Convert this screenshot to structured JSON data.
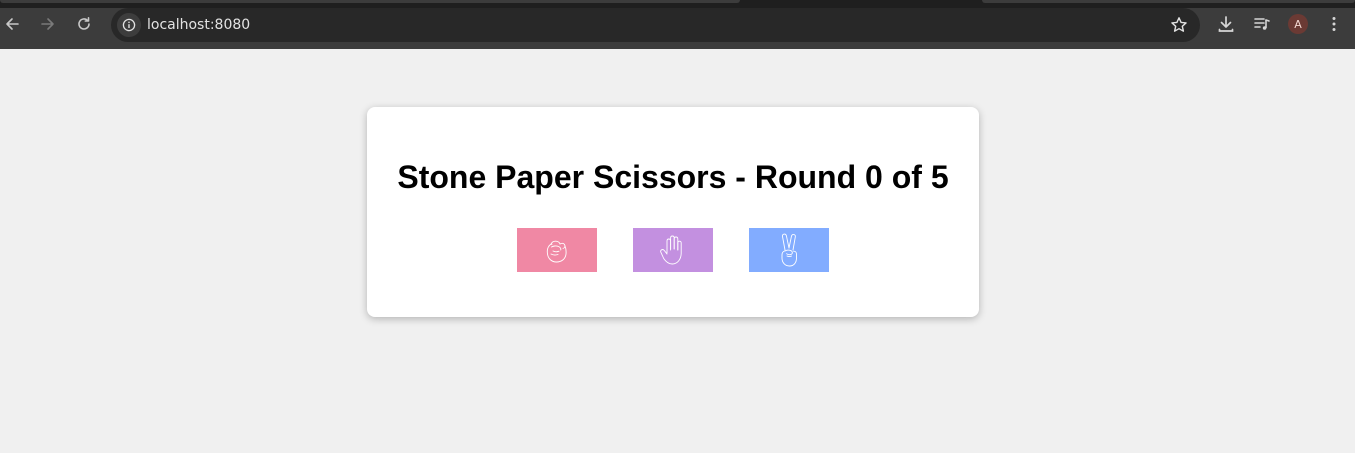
{
  "browser": {
    "url": "localhost:8080",
    "profile_initial": "A",
    "icons": {
      "back": "back-arrow-icon",
      "forward": "forward-arrow-icon",
      "reload": "reload-icon",
      "site_info": "info-icon",
      "bookmark": "star-icon",
      "downloads": "download-icon",
      "media": "media-queue-icon",
      "menu": "kebab-menu-icon"
    }
  },
  "game": {
    "title": "Stone Paper Scissors - Round 0 of 5",
    "choices": [
      {
        "name": "stone",
        "icon": "fist-icon",
        "color": "#f088a4"
      },
      {
        "name": "paper",
        "icon": "open-hand-icon",
        "color": "#c390e0"
      },
      {
        "name": "scissors",
        "icon": "peace-hand-icon",
        "color": "#82acff"
      }
    ]
  }
}
